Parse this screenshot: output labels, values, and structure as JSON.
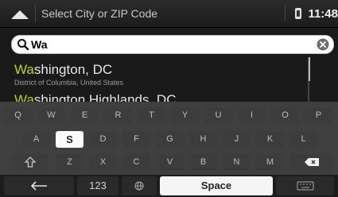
{
  "header": {
    "title": "Select City or ZIP Code",
    "clock": "11:48"
  },
  "search": {
    "value": "Wa"
  },
  "results": [
    {
      "highlight": "Wa",
      "rest": "shington, DC",
      "subtitle": "District of Columbia, United States"
    },
    {
      "highlight": "Wa",
      "rest": "shington Highlands, DC",
      "subtitle": ""
    }
  ],
  "keyboard": {
    "row1": [
      "Q",
      "W",
      "E",
      "R",
      "T",
      "Y",
      "U",
      "I",
      "O",
      "P"
    ],
    "row2": [
      "A",
      "S",
      "D",
      "F",
      "G",
      "H",
      "J",
      "K",
      "L"
    ],
    "row3": [
      "Z",
      "X",
      "C",
      "V",
      "B",
      "N",
      "M"
    ],
    "active_key": "S",
    "numbers_label": "123",
    "space_label": "Space"
  },
  "icons": {
    "back": "up-arrow-icon",
    "gps": "gps-icon",
    "search": "search-icon",
    "clear": "clear-icon",
    "shift": "shift-icon",
    "backspace": "backspace-icon",
    "left_arrow": "left-arrow-icon",
    "globe": "globe-icon",
    "keyboard_hide": "keyboard-hide-icon"
  },
  "colors": {
    "highlight": "#b7d22c",
    "background": "#1a1a1a"
  }
}
